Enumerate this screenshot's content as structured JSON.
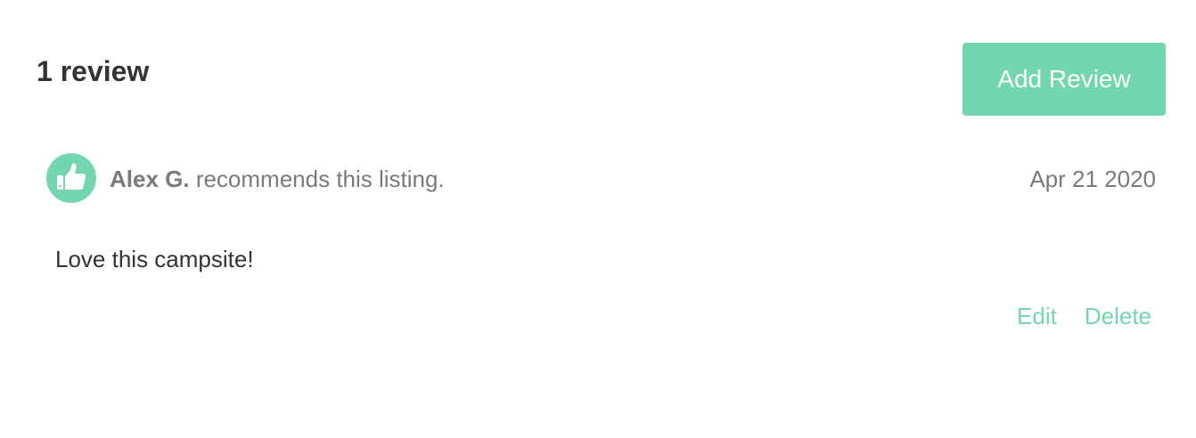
{
  "reviews": {
    "count_label": "1 review",
    "add_button_label": "Add Review"
  },
  "review": {
    "reviewer_name": "Alex G.",
    "recommendation_text": " recommends this listing.",
    "date": "Apr 21 2020",
    "body": "Love this campsite!",
    "edit_label": "Edit",
    "delete_label": "Delete",
    "recommend_icon": "thumbs-up-icon"
  },
  "colors": {
    "accent": "#72d6af",
    "text_dark": "#333333",
    "text_muted": "#7a7a7a"
  }
}
